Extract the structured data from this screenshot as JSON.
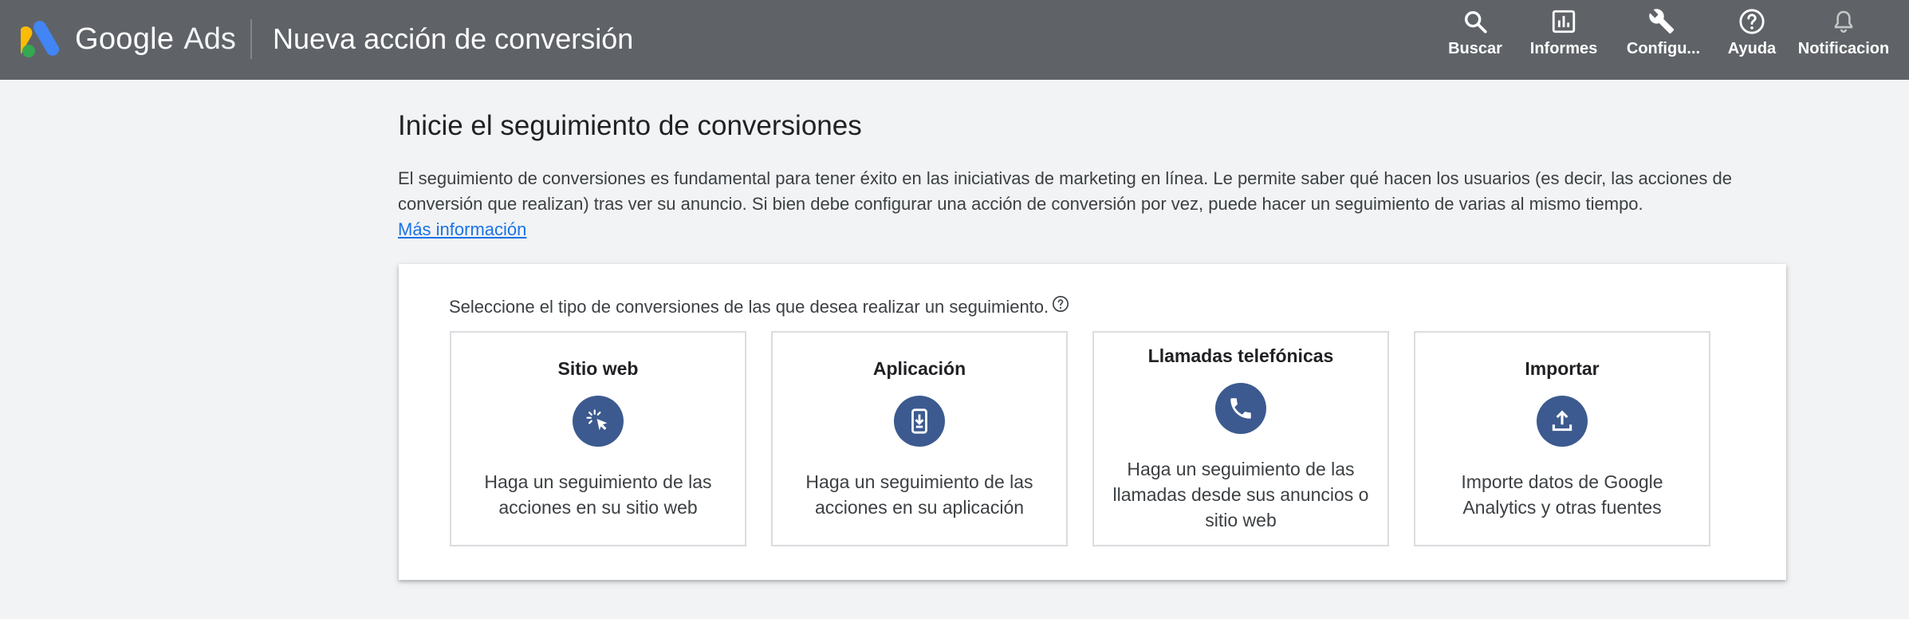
{
  "header": {
    "brand_google": "Google",
    "brand_ads": "Ads",
    "title": "Nueva acción de conversión",
    "nav": [
      {
        "label": "Buscar",
        "icon": "search-icon"
      },
      {
        "label": "Informes",
        "icon": "reports-icon"
      },
      {
        "label": "Configu...",
        "icon": "wrench-icon"
      },
      {
        "label": "Ayuda",
        "icon": "help-icon"
      },
      {
        "label": "Notificacion",
        "icon": "bell-icon"
      }
    ]
  },
  "intro": {
    "title": "Inicie el seguimiento de conversiones",
    "text": "El seguimiento de conversiones es fundamental para tener éxito en las iniciativas de marketing en línea. Le permite saber qué hacen los usuarios (es decir, las acciones de conversión que realizan) tras ver su anuncio. Si bien debe configurar una acción de conversión por vez, puede hacer un seguimiento de varias al mismo tiempo.",
    "link": "Más información"
  },
  "card": {
    "prompt": "Seleccione el tipo de conversiones de las que desea realizar un seguimiento.",
    "options": [
      {
        "title": "Sitio web",
        "desc": "Haga un seguimiento de las acciones en su sitio web",
        "icon": "cursor-click-icon"
      },
      {
        "title": "Aplicación",
        "desc": "Haga un seguimiento de las acciones en su aplicación",
        "icon": "phone-download-icon"
      },
      {
        "title": "Llamadas telefónicas",
        "desc": "Haga un seguimiento de las llamadas desde sus anuncios o sitio web",
        "icon": "phone-call-icon"
      },
      {
        "title": "Importar",
        "desc": "Importe datos de Google Analytics y otras fuentes",
        "icon": "upload-icon"
      }
    ]
  },
  "colors": {
    "topbar": "#5f6368",
    "page_background": "#f1f3f4",
    "link": "#1a73e8",
    "icon_circle": "#3c5a8f"
  }
}
